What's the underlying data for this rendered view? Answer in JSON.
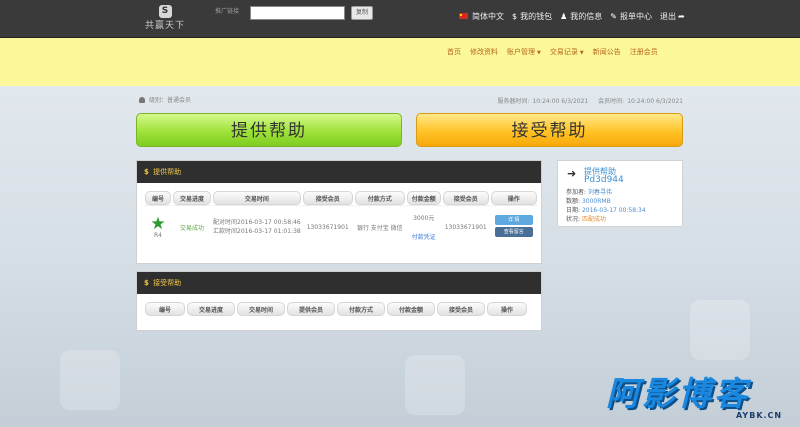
{
  "topbar": {
    "logo_mark": "S",
    "logo_text": "共赢天下",
    "account_label": "推广链接",
    "search_value": "",
    "search_button": "复制",
    "nav": [
      {
        "label": "简体中文",
        "icon": "flag-icon"
      },
      {
        "label": "我的钱包",
        "icon": "dollar-icon"
      },
      {
        "label": "我的信息",
        "icon": "user-icon"
      },
      {
        "label": "报单中心",
        "icon": "edit-icon"
      },
      {
        "label": "退出",
        "icon": "share-icon"
      }
    ]
  },
  "mainnav": {
    "items": [
      {
        "label": "首页"
      },
      {
        "label": "修改资料"
      },
      {
        "label": "账户管理"
      },
      {
        "label": "交易记录"
      },
      {
        "label": "新闻公告"
      },
      {
        "label": "注册会员"
      }
    ]
  },
  "crumb": {
    "label": "级别：普通会员"
  },
  "times": {
    "server_label": "服务器时间:",
    "server_value": "10:24:00 6/3/2021",
    "local_label": "会员时间:",
    "local_value": "10:24:00 6/3/2021"
  },
  "buttons": {
    "provide": "提供帮助",
    "accept": "接受帮助"
  },
  "panel1": {
    "title": "提供帮助",
    "headers": [
      "编号",
      "交易进度",
      "交易时间",
      "接受会员",
      "付款方式",
      "付款金额",
      "接受会员",
      "操作"
    ],
    "row": {
      "no": "R4",
      "status": "交易成功",
      "time1": "配对时间2016-03-17 00:58:46",
      "time2": "汇款时间2016-03-17 01:01:38",
      "member1": "13033671901",
      "pay_method": "银行 支付宝 微信",
      "amount": "3000元",
      "proof": "付款凭证",
      "member2": "13033671901",
      "op_detail": "详 情",
      "op_chat": "查看留言"
    }
  },
  "panel2": {
    "title": "接受帮助",
    "headers": [
      "编号",
      "交易进度",
      "交易时间",
      "提供会员",
      "付款方式",
      "付款金额",
      "接受会员",
      "操作"
    ]
  },
  "card": {
    "title": "提供帮助",
    "id": "Pd3d944",
    "lines": [
      {
        "k": "参加者:",
        "v": "刘春寻伟"
      },
      {
        "k": "数额:",
        "v": "3000RMB"
      },
      {
        "k": "日期:",
        "v": "2016-03-17 00:58:34"
      },
      {
        "k": "状况:",
        "v": "匹配成功"
      }
    ]
  },
  "watermark": {
    "text": "阿影博客",
    "sub": "AYBK.CN"
  }
}
